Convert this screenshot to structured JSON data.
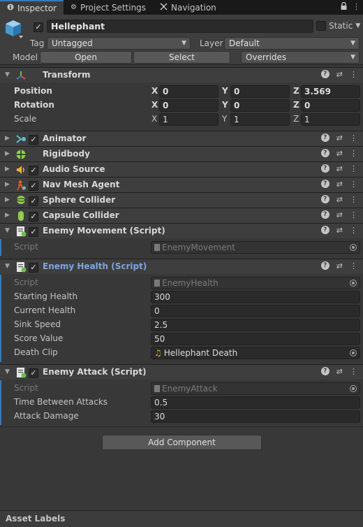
{
  "tabs": [
    {
      "label": "Inspector",
      "icon": "info-icon"
    },
    {
      "label": "Project Settings",
      "icon": "gear-icon"
    },
    {
      "label": "Navigation",
      "icon": "navigation-icon"
    }
  ],
  "gameobject": {
    "name": "Hellephant",
    "static_label": "Static",
    "tag_label": "Tag",
    "tag_value": "Untagged",
    "layer_label": "Layer",
    "layer_value": "Default",
    "model_label": "Model",
    "open_label": "Open",
    "select_label": "Select",
    "overrides_label": "Overrides"
  },
  "transform": {
    "title": "Transform",
    "position_label": "Position",
    "rotation_label": "Rotation",
    "scale_label": "Scale",
    "x": "X",
    "y": "Y",
    "z": "Z",
    "position": [
      "0",
      "0",
      "3.569"
    ],
    "rotation": [
      "0",
      "0",
      "0"
    ],
    "scale": [
      "1",
      "1",
      "1"
    ]
  },
  "components": [
    {
      "title": "Animator",
      "icon": "animator-icon"
    },
    {
      "title": "Rigidbody",
      "icon": "rigidbody-icon"
    },
    {
      "title": "Audio Source",
      "icon": "audio-source-icon"
    },
    {
      "title": "Nav Mesh Agent",
      "icon": "nav-mesh-agent-icon"
    },
    {
      "title": "Sphere Collider",
      "icon": "sphere-collider-icon"
    },
    {
      "title": "Capsule Collider",
      "icon": "capsule-collider-icon"
    }
  ],
  "enemy_movement": {
    "title": "Enemy Movement (Script)",
    "script_label": "Script",
    "script_value": "EnemyMovement"
  },
  "enemy_health": {
    "title": "Enemy Health (Script)",
    "script_label": "Script",
    "script_value": "EnemyHealth",
    "starting_health_label": "Starting Health",
    "starting_health": "300",
    "current_health_label": "Current Health",
    "current_health": "0",
    "sink_speed_label": "Sink Speed",
    "sink_speed": "2.5",
    "score_value_label": "Score Value",
    "score_value": "50",
    "death_clip_label": "Death Clip",
    "death_clip": "Hellephant Death"
  },
  "enemy_attack": {
    "title": "Enemy Attack (Script)",
    "script_label": "Script",
    "script_value": "EnemyAttack",
    "time_between_attacks_label": "Time Between Attacks",
    "time_between_attacks": "0.5",
    "attack_damage_label": "Attack Damage",
    "attack_damage": "30"
  },
  "add_component_label": "Add Component",
  "footer_label": "Asset Labels",
  "colors": {
    "accent": "#3a79bb",
    "highlight_title": "#7ea6e0",
    "panel": "#383838"
  }
}
